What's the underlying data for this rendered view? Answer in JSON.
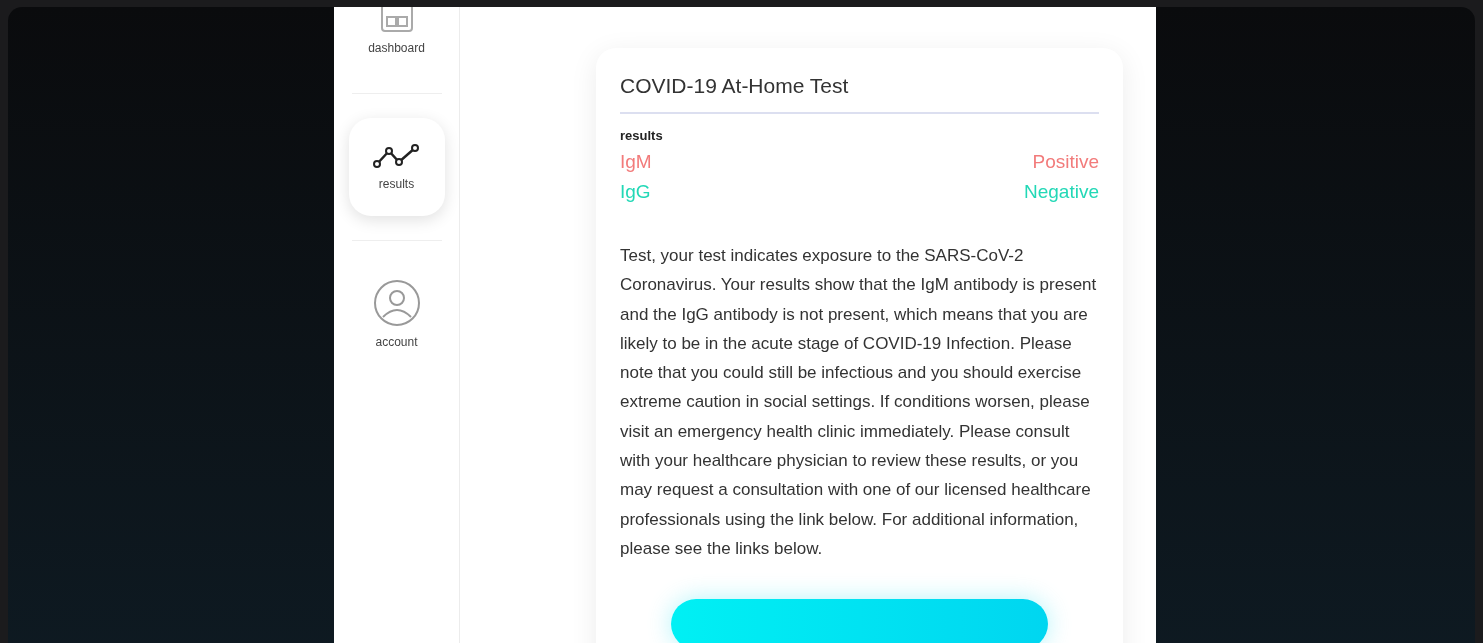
{
  "sidebar": {
    "items": [
      {
        "label": "dashboard",
        "kind": "dashboard",
        "selected": false
      },
      {
        "label": "results",
        "kind": "chart",
        "selected": true
      },
      {
        "label": "account",
        "kind": "account",
        "selected": false
      }
    ]
  },
  "card": {
    "title": "COVID-19 At-Home Test",
    "results_label": "results",
    "results": [
      {
        "name": "IgM",
        "value": "Positive",
        "color": "#f27b7b"
      },
      {
        "name": "IgG",
        "value": "Negative",
        "color": "#22d8b6"
      }
    ],
    "message": "Test, your test indicates exposure to the SARS-CoV-2 Coronavirus. Your results show that the IgM antibody is present and the IgG antibody is not present, which means that you are likely to be in the acute stage of COVID-19 Infection. Please note that you could still be infectious and you should exercise extreme caution in social settings. If conditions worsen, please visit an emergency health clinic immediately. Please consult with your healthcare physician to review these results, or you may request a consultation with one of our licensed healthcare professionals using the link below. For additional information, please see the links below."
  }
}
